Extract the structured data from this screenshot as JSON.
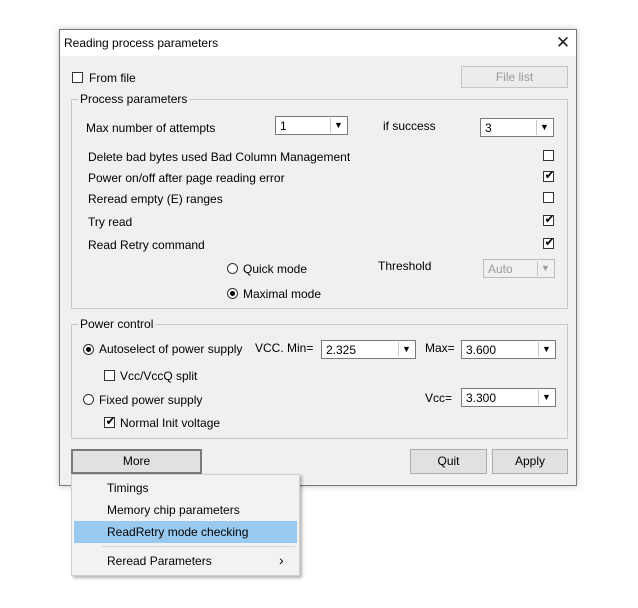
{
  "dialog": {
    "title": "Reading process parameters",
    "close_glyph": "✕",
    "from_file_label": "From file",
    "from_file_checked": false,
    "file_list_button": "File list"
  },
  "process": {
    "group_label": "Process parameters",
    "max_attempts_label": "Max number of attempts",
    "max_attempts_value": "1",
    "if_success_label": "if success",
    "if_success_value": "3",
    "options": [
      {
        "label": "Delete bad bytes used Bad Column Management",
        "checked": false
      },
      {
        "label": "Power on/off after page reading error",
        "checked": true
      },
      {
        "label": "Reread empty (E) ranges",
        "checked": false
      },
      {
        "label": "Try read",
        "checked": true
      },
      {
        "label": "Read Retry command",
        "checked": true
      }
    ],
    "quick_mode_label": "Quick mode",
    "maximal_mode_label": "Maximal mode",
    "threshold_label": "Threshold",
    "threshold_value": "Auto"
  },
  "power": {
    "group_label": "Power control",
    "autoselect_label": "Autoselect of power supply",
    "vcc_min_label": "VCC. Min=",
    "vcc_min_value": "2.325",
    "max_label": "Max=",
    "max_value": "3.600",
    "vcc_split_label": "Vcc/VccQ split",
    "fixed_label": "Fixed power supply",
    "vcc_label": "Vcc=",
    "vcc_value": "3.300",
    "normal_init_label": "Normal Init voltage"
  },
  "buttons": {
    "more": "More",
    "quit": "Quit",
    "apply": "Apply"
  },
  "menu": {
    "items": [
      "Timings",
      "Memory chip parameters",
      "ReadRetry mode checking",
      "Reread Parameters"
    ],
    "highlighted_index": 2,
    "submenu_arrow": "›"
  },
  "colors": {
    "menu_highlight": "#99c9ef",
    "dialog_bg": "#f0f0f0"
  }
}
